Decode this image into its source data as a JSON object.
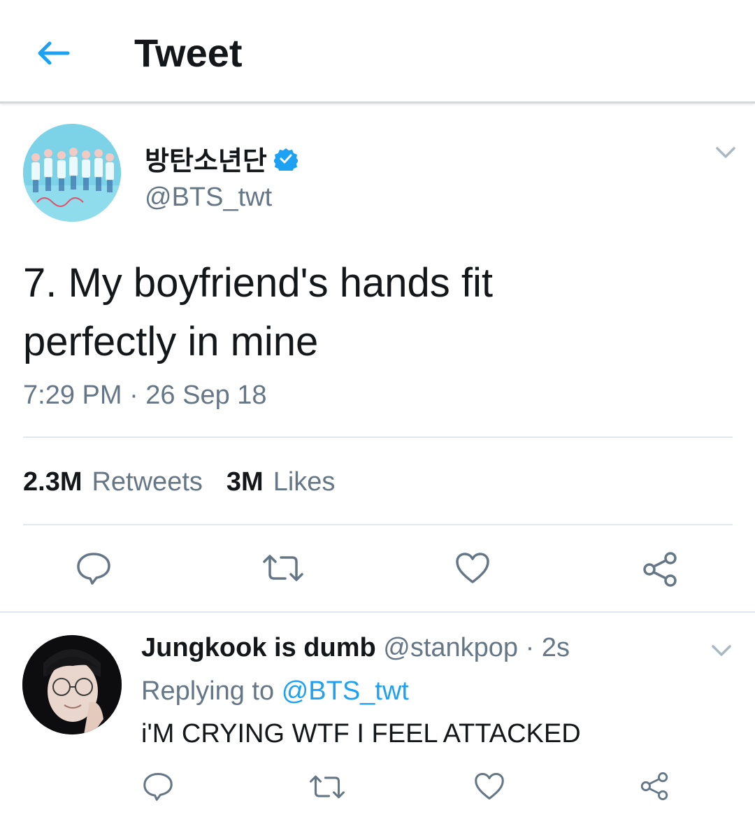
{
  "header": {
    "title": "Tweet",
    "back_icon": "arrow-left-icon"
  },
  "tweet": {
    "display_name": "방탄소년단",
    "handle": "@BTS_twt",
    "text_line1": "7. My boyfriend's hands fit",
    "text_line2": "perfectly in mine",
    "timestamp": "7:29 PM · 26 Sep 18",
    "retweets_count": "2.3M",
    "retweets_label": "Retweets",
    "likes_count": "3M",
    "likes_label": "Likes"
  },
  "reply": {
    "display_name": "Jungkook is dumb",
    "handle_time": "@stankpop · 2s",
    "replying_prefix": "Replying to",
    "replying_handle": "@BTS_twt",
    "text": "i'M CRYING WTF I FEEL ATTACKED"
  },
  "colors": {
    "accent": "#1da1f2",
    "icon_gray": "#657786",
    "text": "#14171a"
  }
}
